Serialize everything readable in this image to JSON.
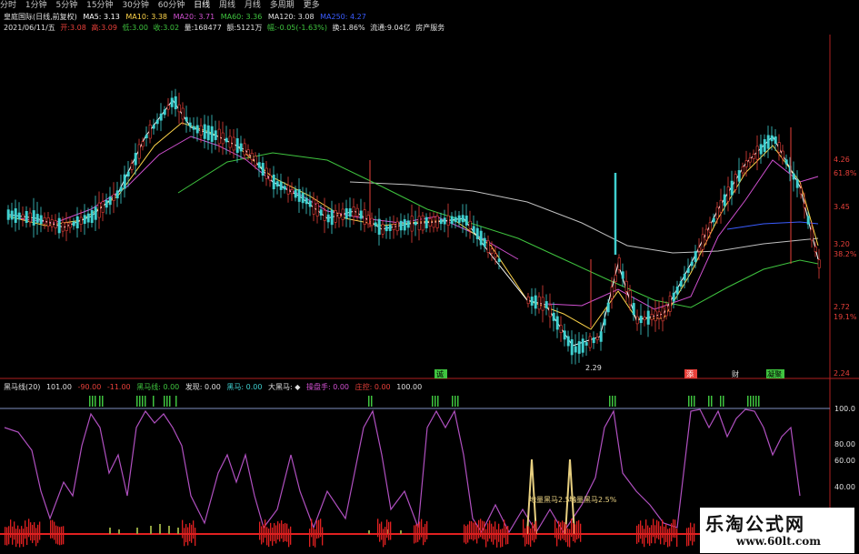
{
  "colors": {
    "up": "#e8403a",
    "down": "#3fd0d0",
    "ma5": "#ffffff",
    "ma10": "#ffd54a",
    "ma20": "#d050d0",
    "ma60": "#3fc43f",
    "ma120": "#c0c0c0",
    "ma250": "#3a5cff",
    "axis": "#b02020",
    "indicator": "#b050c0"
  },
  "tabbar": {
    "items": [
      "分时",
      "1分钟",
      "5分钟",
      "15分钟",
      "30分钟",
      "60分钟",
      "日线",
      "周线",
      "月线",
      "多周期",
      "更多"
    ],
    "active": "日线"
  },
  "stock": {
    "name": "皇庭国际(日线,前复权)",
    "date": "2021/06/11/五",
    "open": "开:3.08",
    "high": "高:3.09",
    "low": "低:3.00",
    "close": "收:3.02",
    "volume": "量:168477",
    "amount": "额:5121万",
    "change": "幅:-0.05(-1.63%)",
    "turnover": "换:1.86%",
    "circulation": "流通:9.04亿",
    "industry": "房产服务"
  },
  "ma": {
    "ma5": "MA5: 3.13",
    "ma10": "MA10: 3.38",
    "ma20": "MA20: 3.71",
    "ma60": "MA60: 3.36",
    "ma120": "MA120: 3.08",
    "ma250": "MA250: 4.27"
  },
  "price_axis": [
    "4.26",
    "61.8%",
    "3.45",
    "3.20",
    "38.2%",
    "2.72",
    "19.1%",
    "2.24"
  ],
  "price_marks": {
    "low": "2.29",
    "signals": [
      "诚",
      "添",
      "财",
      "凝聚"
    ]
  },
  "indicator": {
    "title": "黑马线(20)",
    "v1": "101.00",
    "v2": "-90.00",
    "v3": "-11.00",
    "hm": "黑马线: 0.00",
    "fb": "发现: 0.00",
    "hm2": "黑马: 0.00",
    "dhm": "大黑马: ◆",
    "cp": "操盘手: 0.00",
    "zc": "庄控: 0.00",
    "v4": "100.00",
    "axis": [
      "100.0",
      "80.00",
      "60.00",
      "40.00"
    ],
    "note1": "地量黑马2.5%",
    "note2": "地量黑马2.5%"
  },
  "watermark": {
    "line1": "乐淘公式网",
    "line2": "www.60lt.com"
  }
}
